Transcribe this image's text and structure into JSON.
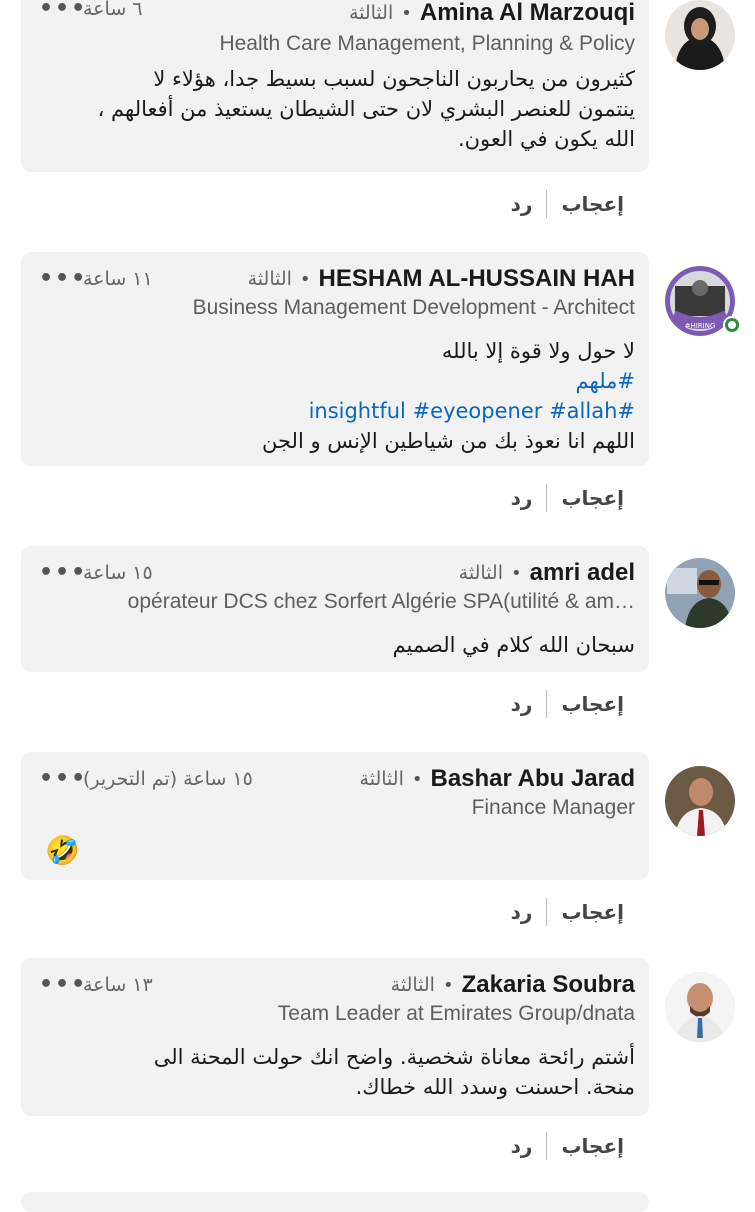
{
  "comments": [
    {
      "name": "Amina Al Marzouqi",
      "day": "الثالثة",
      "time": "٦ ساعة",
      "headline": "Health Care Management, Planning & Policy",
      "lines": [
        "كثيرون من يحاربون الناجحون لسبب بسيط جدا، هؤلاء لا",
        "ينتمون للعنصر البشري لان حتى الشيطان يستعيذ من أفعالهم ،",
        "الله يكون في العون."
      ],
      "like": "إعجاب",
      "reply": "رد"
    },
    {
      "name": "HESHAM AL-HUSSAIN HAH",
      "day": "الثالثة",
      "time": "١١ ساعة",
      "headline": "Business Management Development - Architect",
      "avatar_badge": "#HIRING",
      "lines": [
        "لا حول ولا قوة إلا بالله"
      ],
      "hashtag_lines": [
        "#ملهم",
        "#insightful #eyeopener #allah"
      ],
      "after_lines": [
        "اللهم انا نعوذ بك من شياطين الإنس و الجن"
      ],
      "like": "إعجاب",
      "reply": "رد"
    },
    {
      "name": "amri adel",
      "day": "الثالثة",
      "time": "١٥ ساعة",
      "headline": "opérateur DCS chez Sorfert Algérie SPA(utilité & am…",
      "lines": [
        "سبحان الله كلام في الصميم"
      ],
      "like": "إعجاب",
      "reply": "رد"
    },
    {
      "name": "Bashar Abu Jarad",
      "day": "الثالثة",
      "time": "١٥ ساعة (تم التحرير)",
      "headline": "Finance Manager",
      "emoji": "🤣",
      "like": "إعجاب",
      "reply": "رد"
    },
    {
      "name": "Zakaria Soubra",
      "day": "الثالثة",
      "time": "١٣ ساعة",
      "headline": "Team Leader at Emirates Group/dnata",
      "lines": [
        "أشتم رائحة معاناة شخصية. واضح انك حولت المحنة الى",
        "منحة. احسنت وسدد الله خطاك."
      ],
      "like": "إعجاب",
      "reply": "رد"
    }
  ],
  "more_icon": "more-horizontal-icon",
  "colors": {
    "bubble": "#f2f2f2",
    "hashtag": "#0a66c2",
    "hiring_ring": "#7d5bb5",
    "online": "#2e8b3a"
  }
}
